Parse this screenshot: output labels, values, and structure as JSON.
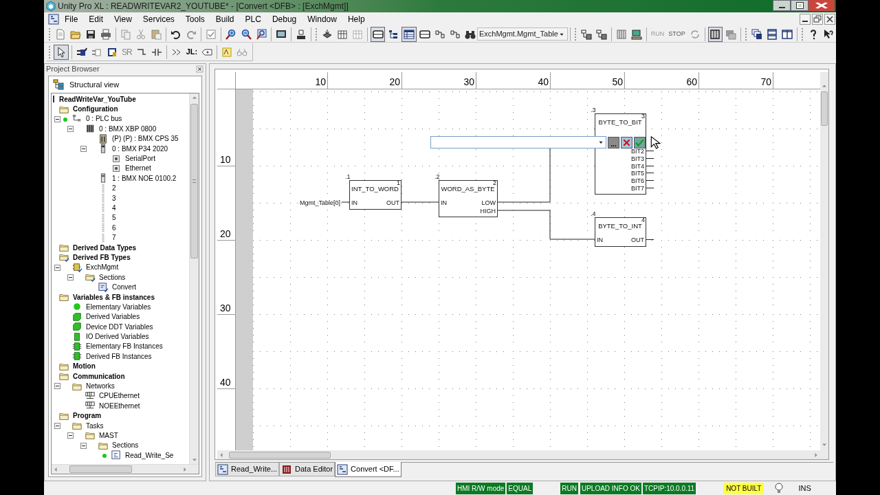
{
  "window": {
    "title": "Unity Pro XL : READWRITEVAR2_YOUTUBE* - [Convert <DFB> : [ExchMgmt]]"
  },
  "menu": [
    "File",
    "Edit",
    "View",
    "Services",
    "Tools",
    "Build",
    "PLC",
    "Debug",
    "Window",
    "Help"
  ],
  "toolbar": {
    "find_combo": "ExchMgmt.Mgmt_Table",
    "run_label": "RUN",
    "stop_label": "STOP"
  },
  "fbd_toolbar": {
    "set_reset_label": "SR",
    "jump_label": "JL:"
  },
  "project_browser": {
    "title": "Project Browser",
    "view": "Structural view",
    "tree": [
      {
        "label": "ReadWriteVar_YouTube",
        "kind": "project",
        "online": false,
        "children": [
          {
            "label": "Configuration",
            "kind": "folder",
            "online": false,
            "children": [
              {
                "label": "0 : PLC bus",
                "kind": "bus",
                "online": true,
                "children": [
                  {
                    "label": "0 : BMX XBP 0800",
                    "kind": "rack",
                    "online": false,
                    "children": [
                      {
                        "label": "(P) (P) : BMX CPS 35",
                        "kind": "power",
                        "online": false
                      },
                      {
                        "label": "0 : BMX P34 2020",
                        "kind": "cpu",
                        "online": false,
                        "children": [
                          {
                            "label": "SerialPort",
                            "kind": "port",
                            "online": false
                          },
                          {
                            "label": "Ethernet",
                            "kind": "port",
                            "online": false
                          }
                        ]
                      },
                      {
                        "label": "1 : BMX NOE 0100.2",
                        "kind": "module",
                        "online": false
                      },
                      {
                        "label": "2",
                        "kind": "slot",
                        "online": false
                      },
                      {
                        "label": "3",
                        "kind": "slot",
                        "online": false
                      },
                      {
                        "label": "4",
                        "kind": "slot",
                        "online": false
                      },
                      {
                        "label": "5",
                        "kind": "slot",
                        "online": false
                      },
                      {
                        "label": "6",
                        "kind": "slot",
                        "online": false
                      },
                      {
                        "label": "7",
                        "kind": "slot",
                        "online": false
                      }
                    ]
                  }
                ]
              }
            ]
          },
          {
            "label": "Derived Data Types",
            "kind": "folder",
            "online": false
          },
          {
            "label": "Derived FB Types",
            "kind": "checked-folder",
            "online": false,
            "children": [
              {
                "label": "ExchMgmt",
                "kind": "fb-type",
                "online": false,
                "children": [
                  {
                    "label": "Sections",
                    "kind": "checked-folder",
                    "online": false,
                    "children": [
                      {
                        "label": "Convert",
                        "kind": "checked-section",
                        "online": false
                      }
                    ]
                  }
                ]
              }
            ]
          },
          {
            "label": "Variables & FB instances",
            "kind": "folder",
            "online": false,
            "children": [
              {
                "label": "Elementary Variables",
                "kind": "var-dot",
                "online": false
              },
              {
                "label": "Derived Variables",
                "kind": "var-block",
                "online": false
              },
              {
                "label": "Device DDT Variables",
                "kind": "var-block",
                "online": false
              },
              {
                "label": "IO Derived Variables",
                "kind": "var-io",
                "online": false
              },
              {
                "label": "Elementary FB Instances",
                "kind": "fb-instance",
                "online": false
              },
              {
                "label": "Derived FB Instances",
                "kind": "fb-instance",
                "online": false
              }
            ]
          },
          {
            "label": "Motion",
            "kind": "folder",
            "online": false
          },
          {
            "label": "Communication",
            "kind": "folder",
            "online": false,
            "children": [
              {
                "label": "Networks",
                "kind": "folder",
                "online": false,
                "children": [
                  {
                    "label": "CPUEthernet",
                    "kind": "network",
                    "online": false
                  },
                  {
                    "label": "NOEEthernet",
                    "kind": "network",
                    "online": false
                  }
                ]
              }
            ]
          },
          {
            "label": "Program",
            "kind": "folder",
            "online": false,
            "children": [
              {
                "label": "Tasks",
                "kind": "folder",
                "online": false,
                "children": [
                  {
                    "label": "MAST",
                    "kind": "folder",
                    "online": false,
                    "children": [
                      {
                        "label": "Sections",
                        "kind": "folder",
                        "online": false,
                        "children": [
                          {
                            "label": "Read_Write_Se",
                            "kind": "section",
                            "online": true
                          }
                        ]
                      }
                    ]
                  }
                ]
              }
            ]
          }
        ]
      }
    ]
  },
  "editor": {
    "ruler_columns": [
      "10",
      "20",
      "30",
      "40",
      "50",
      "60",
      "70"
    ],
    "ruler_rows": [
      "10",
      "20",
      "30",
      "40"
    ],
    "input_variable": "Mgmt_Table[0]",
    "blocks": [
      {
        "instance": ".1",
        "number": "1",
        "name": "INT_TO_WORD",
        "inputs": [
          "IN"
        ],
        "outputs": [
          "OUT"
        ]
      },
      {
        "instance": ".2",
        "number": "2",
        "name": "WORD_AS_BYTE",
        "inputs": [
          "IN"
        ],
        "outputs": [
          "LOW",
          "HIGH"
        ]
      },
      {
        "instance": ".3",
        "number": "3",
        "name": "BYTE_TO_BIT",
        "outputs": [
          "BIT2",
          "BIT3",
          "BIT4",
          "BIT5",
          "BIT6",
          "BIT7"
        ]
      },
      {
        "instance": ".4",
        "number": "4",
        "name": "BYTE_TO_INT",
        "inputs": [
          "IN"
        ],
        "outputs": [
          "OUT"
        ]
      }
    ],
    "edit_field": {
      "browse_label": "..."
    }
  },
  "document_tabs": [
    {
      "label": "Read_Write...",
      "kind": "fbd",
      "selected": false
    },
    {
      "label": "Data Editor",
      "kind": "data",
      "selected": false
    },
    {
      "label": "Convert <DF...",
      "kind": "fbd",
      "selected": true
    }
  ],
  "status_bar": [
    {
      "text": "HMI R/W mode",
      "kind": "ok"
    },
    {
      "text": "EQUAL",
      "kind": "ok"
    },
    {
      "text": "RUN",
      "kind": "ok"
    },
    {
      "text": "UPLOAD INFO OK",
      "kind": "ok"
    },
    {
      "text": "TCPIP:10.0.0.11",
      "kind": "ok"
    },
    {
      "text": "NOT BUILT",
      "kind": "warning"
    },
    {
      "kind": "bulb"
    },
    {
      "text": "INS",
      "kind": "plain"
    }
  ]
}
